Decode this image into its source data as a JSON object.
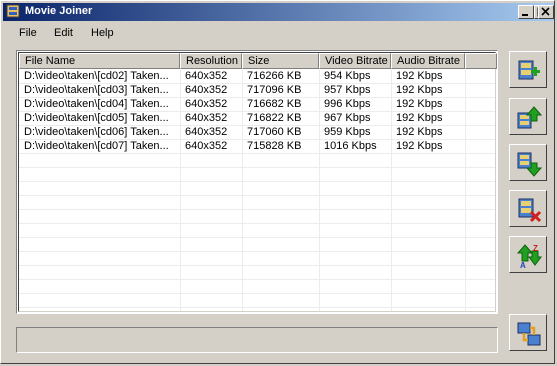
{
  "window": {
    "title": "Movie Joiner"
  },
  "menu": [
    {
      "label": "File"
    },
    {
      "label": "Edit"
    },
    {
      "label": "Help"
    }
  ],
  "columns": [
    "File Name",
    "Resolution",
    "Size",
    "Video Bitrate",
    "Audio Bitrate"
  ],
  "rows": [
    [
      "D:\\video\\taken\\[cd02] Taken...",
      "640x352",
      "716266 KB",
      "954 Kbps",
      "192 Kbps"
    ],
    [
      "D:\\video\\taken\\[cd03] Taken...",
      "640x352",
      "717096 KB",
      "957 Kbps",
      "192 Kbps"
    ],
    [
      "D:\\video\\taken\\[cd04] Taken...",
      "640x352",
      "716682 KB",
      "996 Kbps",
      "192 Kbps"
    ],
    [
      "D:\\video\\taken\\[cd05] Taken...",
      "640x352",
      "716822 KB",
      "967 Kbps",
      "192 Kbps"
    ],
    [
      "D:\\video\\taken\\[cd06] Taken...",
      "640x352",
      "717060 KB",
      "959 Kbps",
      "192 Kbps"
    ],
    [
      "D:\\video\\taken\\[cd07] Taken...",
      "640x352",
      "715828 KB",
      "1016 Kbps",
      "192 Kbps"
    ]
  ],
  "side_buttons": [
    {
      "icon": "add-file-icon"
    },
    {
      "icon": "move-up-icon"
    },
    {
      "icon": "move-down-icon"
    },
    {
      "icon": "remove-file-icon"
    },
    {
      "icon": "sort-az-icon"
    }
  ],
  "join_button": {
    "icon": "join-movies-icon"
  },
  "status": {
    "text": ""
  }
}
